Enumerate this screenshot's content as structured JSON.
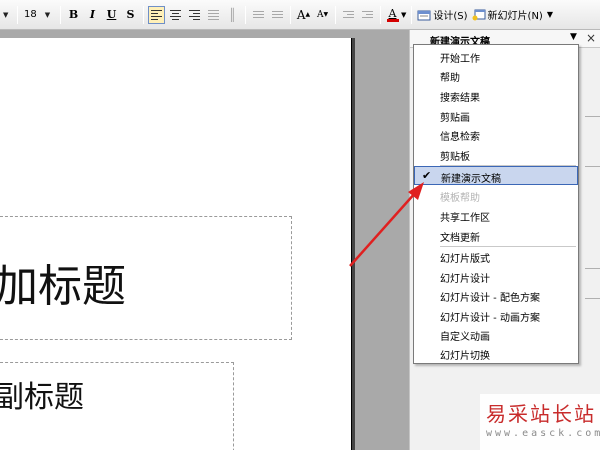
{
  "toolbar": {
    "font_size": "18",
    "bold": "B",
    "italic": "I",
    "underline": "U",
    "shadow": "S",
    "grow_font": "A",
    "shrink_font": "A",
    "font_color": "A",
    "design_label": "设计(S)",
    "new_slide_label": "新幻灯片(N)",
    "accent": "#3b67b6",
    "font_color_bar": "#d40000"
  },
  "slide": {
    "title_text": "加标题",
    "subtitle_text": "副标题"
  },
  "task_pane": {
    "title": "新建演示文稿",
    "close": "×"
  },
  "menu": {
    "items": [
      {
        "label": "开始工作"
      },
      {
        "label": "帮助"
      },
      {
        "label": "搜索结果"
      },
      {
        "label": "剪贴画"
      },
      {
        "label": "信息检索"
      },
      {
        "label": "剪贴板"
      },
      {
        "label": "新建演示文稿",
        "checked": "✔"
      },
      {
        "label": "模板帮助"
      },
      {
        "label": "共享工作区"
      },
      {
        "label": "文档更新"
      },
      {
        "label": "幻灯片版式"
      },
      {
        "label": "幻灯片设计"
      },
      {
        "label": "幻灯片设计 - 配色方案"
      },
      {
        "label": "幻灯片设计 - 动画方案"
      },
      {
        "label": "自定义动画"
      },
      {
        "label": "幻灯片切换"
      }
    ]
  },
  "watermark": {
    "site_name": "易采站长站",
    "url": "www.easck.com"
  },
  "colors": {
    "arrow": "#e02020",
    "selected_bg": "#c9d6ee"
  }
}
